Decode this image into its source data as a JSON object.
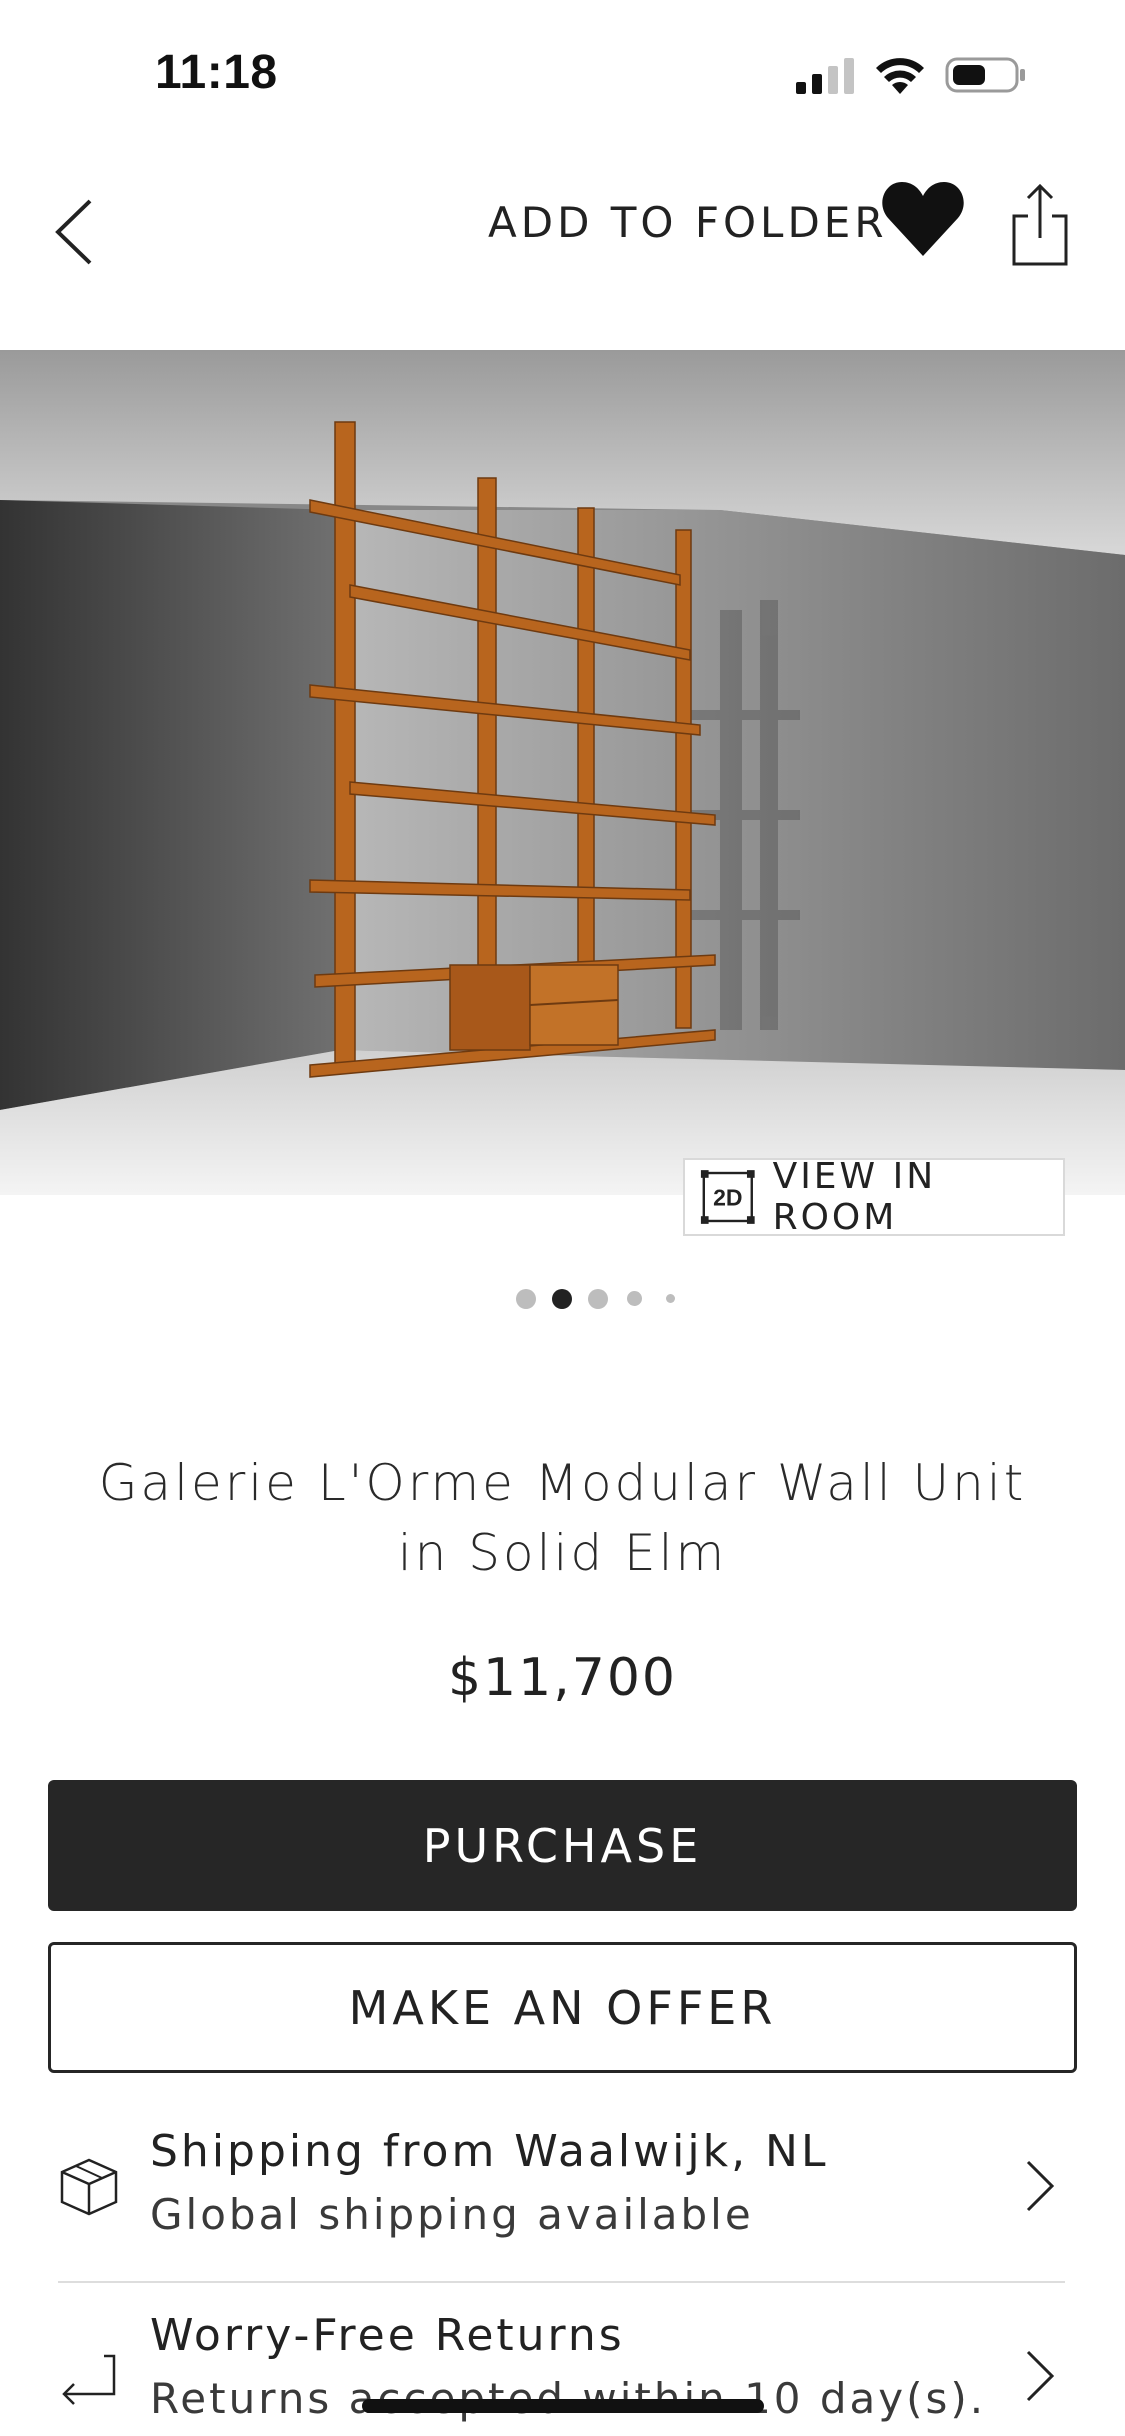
{
  "status_bar": {
    "time": "11:18",
    "icons": [
      "signal-icon",
      "wifi-icon",
      "battery-icon"
    ]
  },
  "nav": {
    "add_to_folder": "ADD TO FOLDER",
    "icons": [
      "chevron-left-icon",
      "heart-icon",
      "share-icon"
    ]
  },
  "hero": {
    "view_in_room_badge": "2D",
    "view_in_room_label": "VIEW IN ROOM",
    "carousel": {
      "count": 5,
      "active_index": 1
    }
  },
  "product": {
    "title": "Galerie L'Orme Modular Wall Unit in Solid Elm",
    "price": "$11,700"
  },
  "actions": {
    "purchase": "PURCHASE",
    "make_offer": "MAKE AN OFFER"
  },
  "info_rows": [
    {
      "title": "Shipping from Waalwijk, NL",
      "subtitle": "Global shipping available",
      "icon": "package-icon"
    },
    {
      "title": "Worry-Free Returns",
      "subtitle": "Returns accepted within 10 day(s).",
      "icon": "return-arrow-icon"
    }
  ],
  "colors": {
    "button_dark": "#262626",
    "text": "#222222",
    "wood": "#b8651e"
  }
}
